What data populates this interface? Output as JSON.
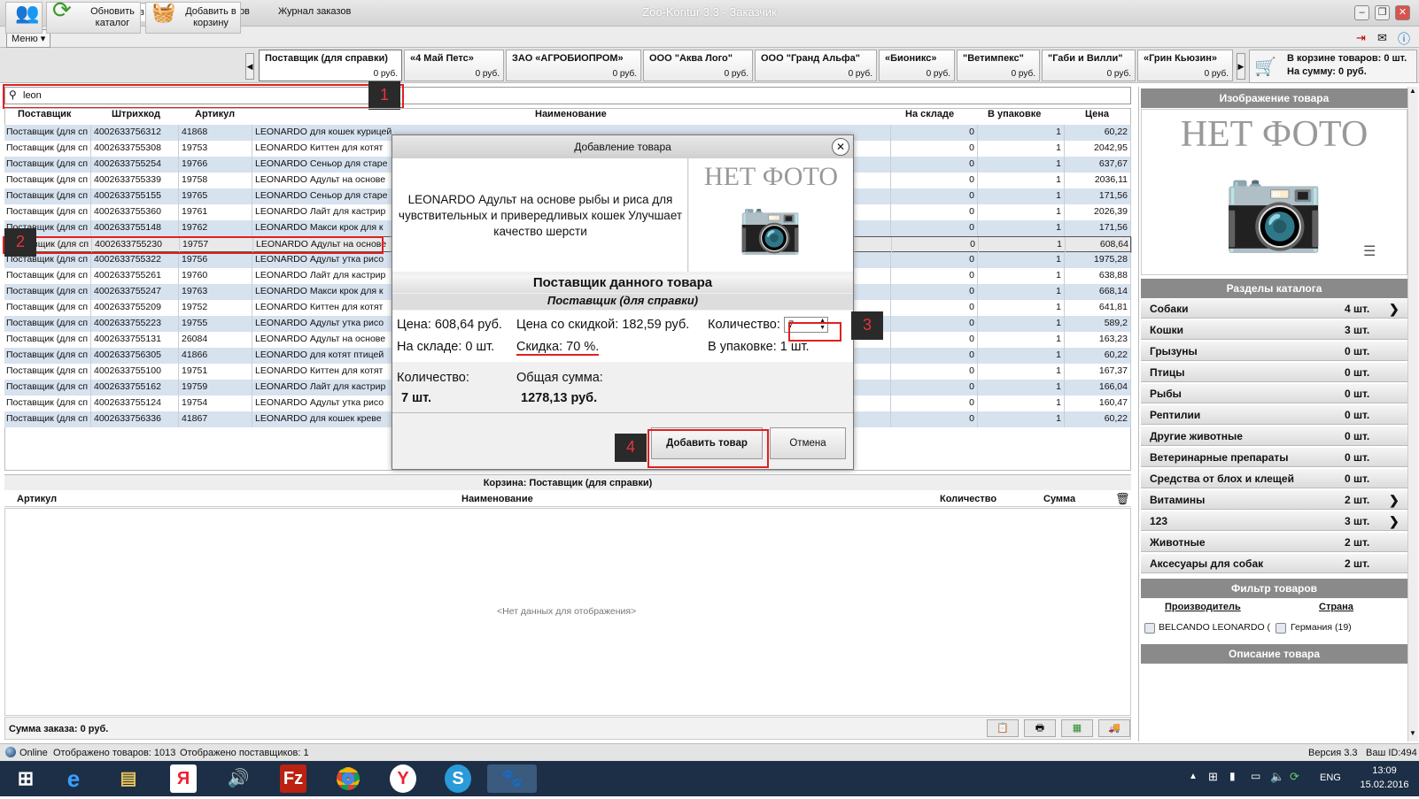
{
  "window": {
    "title": "Zoo-Kontur 3.3 - Заказчик"
  },
  "menu": {
    "menu_label": "Меню",
    "tabs": [
      "Каталог товаров",
      "Корзина товаров",
      "Журнал заказов"
    ]
  },
  "toolbar": {
    "refresh_label": "Обновить каталог",
    "add_to_cart_label": "Добавить в корзину"
  },
  "suppliers": [
    {
      "name": "Поставщик (для справки)",
      "price": "0 руб."
    },
    {
      "name": "«4 Май Петс»",
      "price": "0 руб."
    },
    {
      "name": "ЗАО «АГРОБИОПРОМ»",
      "price": "0 руб."
    },
    {
      "name": "ООО \"Аква Лого\"",
      "price": "0 руб."
    },
    {
      "name": "ООО \"Гранд Альфа\"",
      "price": "0 руб."
    },
    {
      "name": "«Бионикс»",
      "price": "0 руб."
    },
    {
      "name": "\"Ветимпекс\"",
      "price": "0 руб."
    },
    {
      "name": "\"Габи и Вилли\"",
      "price": "0 руб."
    },
    {
      "name": "«Грин Кьюзин»",
      "price": "0 руб."
    }
  ],
  "cart_summary": {
    "items": "В корзине товаров: 0 шт.",
    "sum": "На сумму: 0 руб."
  },
  "search": {
    "value": "leon"
  },
  "badges": [
    "1",
    "2",
    "3",
    "4"
  ],
  "grid": {
    "headers": [
      "Поставщик",
      "Штрихкод",
      "Артикул",
      "Наименование",
      "На складе",
      "В упаковке",
      "Цена"
    ],
    "rows": [
      [
        "Поставщик (для сп",
        "4002633756312",
        "41868",
        "LEONARDO для кошек курицей",
        "0",
        "1",
        "60,22"
      ],
      [
        "Поставщик (для сп",
        "4002633755308",
        "19753",
        "LEONARDO Киттен для котят",
        "0",
        "1",
        "2042,95"
      ],
      [
        "Поставщик (для сп",
        "4002633755254",
        "19766",
        "LEONARDO Сеньор для старе",
        "0",
        "1",
        "637,67"
      ],
      [
        "Поставщик (для сп",
        "4002633755339",
        "19758",
        "LEONARDO Адульт на основе",
        "0",
        "1",
        "2036,11"
      ],
      [
        "Поставщик (для сп",
        "4002633755155",
        "19765",
        "LEONARDO Сеньор для старе",
        "0",
        "1",
        "171,56"
      ],
      [
        "Поставщик (для сп",
        "4002633755360",
        "19761",
        "LEONARDO Лайт для кастрир",
        "0",
        "1",
        "2026,39"
      ],
      [
        "Поставщик (для сп",
        "4002633755148",
        "19762",
        "LEONARDO Макси крок для к",
        "0",
        "1",
        "171,56"
      ],
      [
        "Поставщик (для сп",
        "4002633755230",
        "19757",
        "LEONARDO Адульт на основе",
        "0",
        "1",
        "608,64"
      ],
      [
        "Поставщик (для сп",
        "4002633755322",
        "19756",
        "LEONARDO Адульт утка рисо",
        "0",
        "1",
        "1975,28"
      ],
      [
        "Поставщик (для сп",
        "4002633755261",
        "19760",
        "LEONARDO Лайт для кастрир",
        "0",
        "1",
        "638,88"
      ],
      [
        "Поставщик (для сп",
        "4002633755247",
        "19763",
        "LEONARDO Макси крок для к",
        "0",
        "1",
        "668,14"
      ],
      [
        "Поставщик (для сп",
        "4002633755209",
        "19752",
        "LEONARDO Киттен для котят",
        "0",
        "1",
        "641,81"
      ],
      [
        "Поставщик (для сп",
        "4002633755223",
        "19755",
        "LEONARDO Адульт утка рисо",
        "0",
        "1",
        "589,2"
      ],
      [
        "Поставщик (для сп",
        "4002633755131",
        "26084",
        "LEONARDO Адульт на основе",
        "0",
        "1",
        "163,23"
      ],
      [
        "Поставщик (для сп",
        "4002633756305",
        "41866",
        "LEONARDO для котят птицей",
        "0",
        "1",
        "60,22"
      ],
      [
        "Поставщик (для сп",
        "4002633755100",
        "19751",
        "LEONARDO Киттен для котят",
        "0",
        "1",
        "167,37"
      ],
      [
        "Поставщик (для сп",
        "4002633755162",
        "19759",
        "LEONARDO Лайт для кастрир",
        "0",
        "1",
        "166,04"
      ],
      [
        "Поставщик (для сп",
        "4002633755124",
        "19754",
        "LEONARDO Адульт утка рисо",
        "0",
        "1",
        "160,47"
      ],
      [
        "Поставщик (для сп",
        "4002633756336",
        "41867",
        "LEONARDO для кошек креве",
        "0",
        "1",
        "60,22"
      ]
    ]
  },
  "dialog": {
    "title": "Добавление товара",
    "description": "LEONARDO Адульт на основе рыбы и риса для чувствительных и привередливых кошек Улучшает качество шерсти",
    "no_photo": "НЕТ ФОТО",
    "supplier_header": "Поставщик данного товара",
    "supplier_name": "Поставщик (для справки)",
    "price": "Цена: 608,64 руб.",
    "discount_price": "Цена со скидкой: 182,59 руб.",
    "qty_label": "Количество:",
    "qty_value": "7",
    "stock": "На складе: 0 шт.",
    "discount": "Скидка: 70 %.",
    "pack": "В упаковке: 1 шт.",
    "total_qty_label": "Количество:",
    "total_qty": "7 шт.",
    "total_sum_label": "Общая сумма:",
    "total_sum": "1278,13 руб.",
    "add_button": "Добавить товар",
    "cancel_button": "Отмена"
  },
  "cart": {
    "title": "Корзина: Поставщик (для справки)",
    "headers": [
      "Артикул",
      "Наименование",
      "Количество",
      "Сумма"
    ],
    "empty": "<Нет данных для отображения>",
    "order_sum": "Сумма заказа: 0 руб."
  },
  "sidebar": {
    "image_header": "Изображение товара",
    "no_photo": "НЕТ ФОТО",
    "sections_header": "Разделы каталога",
    "categories": [
      {
        "name": "Собаки",
        "count": "4 шт.",
        "arrow": true
      },
      {
        "name": "Кошки",
        "count": "3 шт.",
        "arrow": false
      },
      {
        "name": "Грызуны",
        "count": "0 шт.",
        "arrow": false
      },
      {
        "name": "Птицы",
        "count": "0 шт.",
        "arrow": false
      },
      {
        "name": "Рыбы",
        "count": "0 шт.",
        "arrow": false
      },
      {
        "name": "Рептилии",
        "count": "0 шт.",
        "arrow": false
      },
      {
        "name": "Другие животные",
        "count": "0 шт.",
        "arrow": false
      },
      {
        "name": "Ветеринарные препараты",
        "count": "0 шт.",
        "arrow": false
      },
      {
        "name": "Средства от блох и клещей",
        "count": "0 шт.",
        "arrow": false
      },
      {
        "name": "Витамины",
        "count": "2 шт.",
        "arrow": true
      },
      {
        "name": "123",
        "count": "3 шт.",
        "arrow": true
      },
      {
        "name": "Животные",
        "count": "2 шт.",
        "arrow": false
      },
      {
        "name": "Аксесуары для собак",
        "count": "2 шт.",
        "arrow": false
      }
    ],
    "filter_header": "Фильтр товаров",
    "filter_manufacturer": "Производитель",
    "filter_country": "Страна",
    "manufacturer_value": "BELCANDO LEONARDO (",
    "country_value": "Германия (19)",
    "description_header": "Описание товара"
  },
  "status": {
    "online": "Online",
    "shown_items": "Отображено товаров: 1013",
    "shown_suppliers": "Отображено поставщиков: 1",
    "version": "Версия 3.3",
    "your_id": "Ваш ID:494"
  },
  "taskbar": {
    "lang": "ENG",
    "time": "13:09",
    "date": "15.02.2016"
  }
}
